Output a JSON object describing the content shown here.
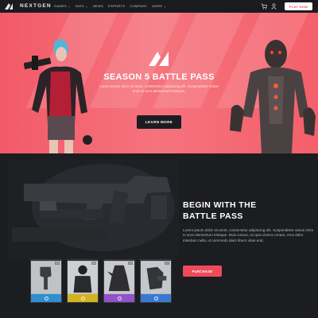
{
  "nav": {
    "brand": "NEXTGEN",
    "menu": [
      "GAMES ⌄",
      "INFO ⌄",
      "NEWS",
      "ESPORTS",
      "COMPANY",
      "MORE ⌄"
    ],
    "play_button": "PLAY NOW"
  },
  "hero": {
    "title": "SEASON 5 BATTLE PASS",
    "subtitle": "Lorem ipsum dolor sit amet, consectetur adipiscing elit. Suspendisse varius enim in eros elementum tristique.",
    "button": "LEARN MORE"
  },
  "section": {
    "title_line1": "BEGIN WITH THE",
    "title_line2": "BATTLE PASS",
    "text": "Lorem ipsum dolor sit amet, consectetur adipiscing elit. Suspendisse varius enim in eros elementum tristique. Duis cursus, mi quis viverra ornare, eros dolor interdum nulla, ut commodo diam libero vitae erat.",
    "button": "PURCHASE"
  },
  "cards": [
    {
      "number": "05",
      "strip_color": "#2f8fcf",
      "art": "rifle-art"
    },
    {
      "number": "14",
      "strip_color": "#d4b21f",
      "art": "soldier-art"
    },
    {
      "number": "12",
      "strip_color": "#8e54c8",
      "art": "creature-art"
    },
    {
      "number": "07",
      "strip_color": "#3a78d0",
      "art": "gear-art"
    }
  ],
  "colors": {
    "accent": "#ef4a5b",
    "hero_bg": "#f5737d",
    "dark_bg": "#1c1d21"
  }
}
